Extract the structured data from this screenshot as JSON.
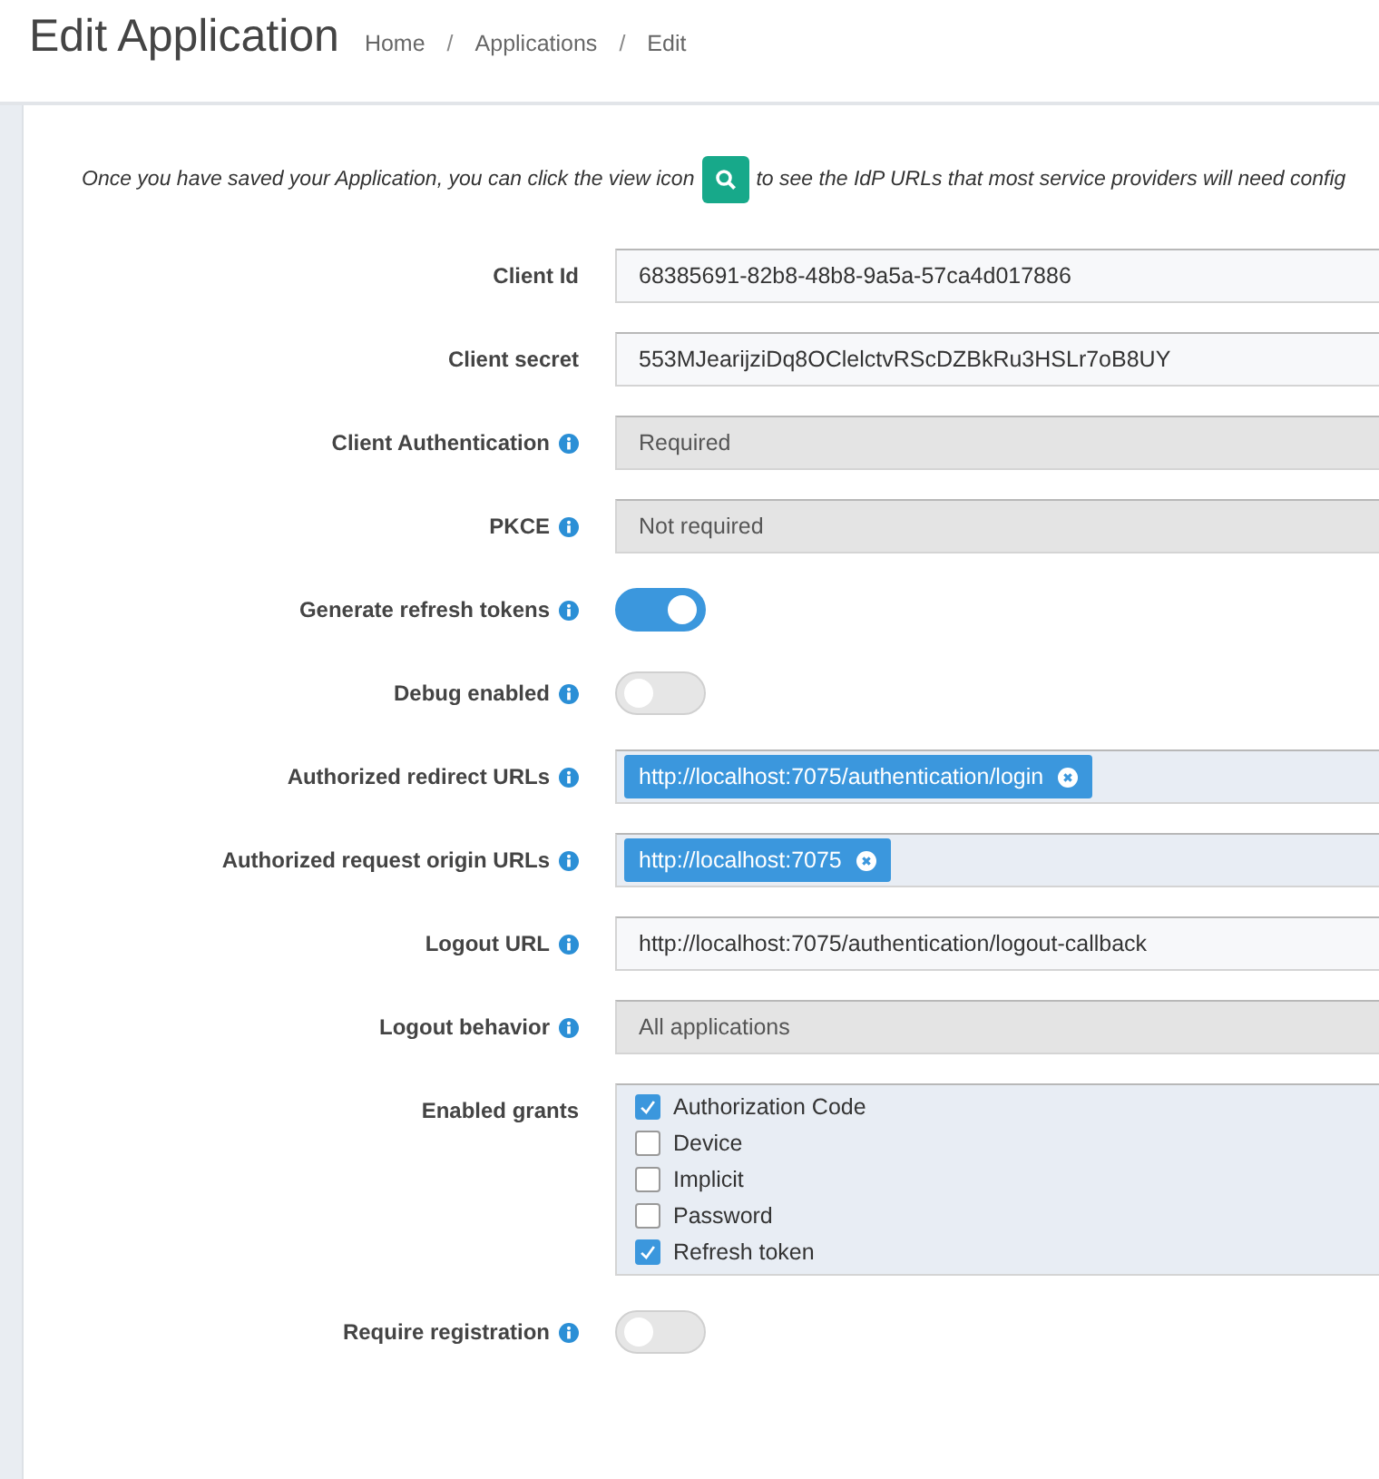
{
  "header": {
    "title": "Edit Application",
    "breadcrumbs": [
      "Home",
      "Applications",
      "Edit"
    ],
    "separator": "/"
  },
  "notice": {
    "before": "Once you have saved your Application, you can click the view icon",
    "after": "to see the IdP URLs that most service providers will need config"
  },
  "fields": [
    {
      "kind": "text",
      "label": "Client Id",
      "info": false,
      "value": "68385691-82b8-48b8-9a5a-57ca4d017886"
    },
    {
      "kind": "text",
      "label": "Client secret",
      "info": false,
      "value": "553MJearijziDq8OClelctvRScDZBkRu3HSLr7oB8UY"
    },
    {
      "kind": "select",
      "label": "Client Authentication",
      "info": true,
      "value": "Required"
    },
    {
      "kind": "select",
      "label": "PKCE",
      "info": true,
      "value": "Not required"
    },
    {
      "kind": "toggle",
      "label": "Generate refresh tokens",
      "info": true,
      "on": true
    },
    {
      "kind": "toggle",
      "label": "Debug enabled",
      "info": true,
      "on": false
    },
    {
      "kind": "tags",
      "label": "Authorized redirect URLs",
      "info": true,
      "tags": [
        "http://localhost:7075/authentication/login"
      ]
    },
    {
      "kind": "tags",
      "label": "Authorized request origin URLs",
      "info": true,
      "tags": [
        "http://localhost:7075"
      ]
    },
    {
      "kind": "text",
      "label": "Logout URL",
      "info": true,
      "value": "http://localhost:7075/authentication/logout-callback"
    },
    {
      "kind": "select",
      "label": "Logout behavior",
      "info": true,
      "value": "All applications"
    },
    {
      "kind": "checks",
      "label": "Enabled grants",
      "info": false,
      "options": [
        {
          "label": "Authorization Code",
          "checked": true
        },
        {
          "label": "Device",
          "checked": false
        },
        {
          "label": "Implicit",
          "checked": false
        },
        {
          "label": "Password",
          "checked": false
        },
        {
          "label": "Refresh token",
          "checked": true
        }
      ]
    },
    {
      "kind": "toggle",
      "label": "Require registration",
      "info": true,
      "on": false
    }
  ]
}
